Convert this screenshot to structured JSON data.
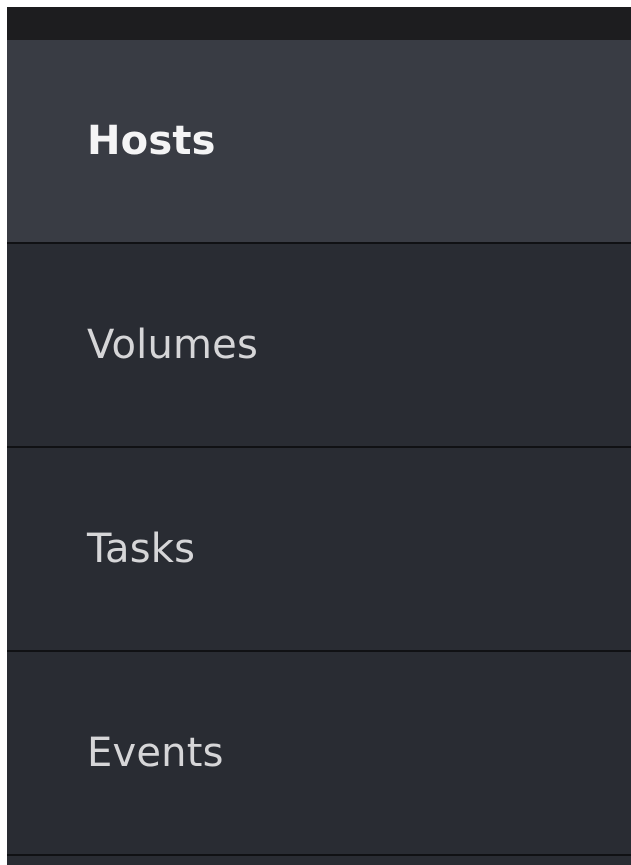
{
  "sidebar": {
    "items": [
      {
        "label": "Hosts",
        "active": true
      },
      {
        "label": "Volumes",
        "active": false
      },
      {
        "label": "Tasks",
        "active": false
      },
      {
        "label": "Events",
        "active": false
      }
    ]
  },
  "colors": {
    "topbar": "#1d1d1f",
    "item_background": "#292c33",
    "active_item_background": "#393c44",
    "divider": "#101114",
    "label_text": "#d6d6d8",
    "active_label_text": "#f4f4f5"
  }
}
